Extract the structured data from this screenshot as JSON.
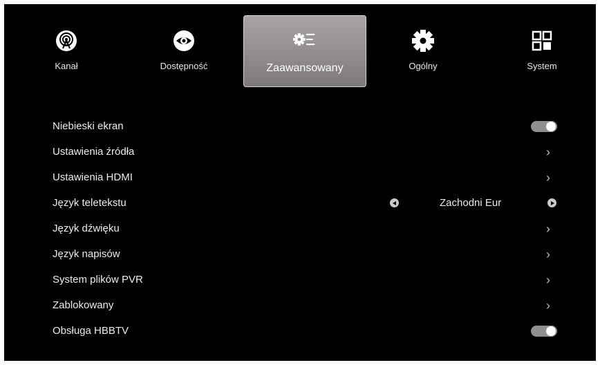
{
  "tabs": [
    {
      "label": "Kanał",
      "icon": "antenna-icon"
    },
    {
      "label": "Dostępność",
      "icon": "eye-icon"
    },
    {
      "label": "Zaawansowany",
      "icon": "gear-list-icon"
    },
    {
      "label": "Ogólny",
      "icon": "gear-icon"
    },
    {
      "label": "System",
      "icon": "grid-icon"
    }
  ],
  "active_tab": 2,
  "settings": [
    {
      "label": "Niebieski ekran",
      "control": "toggle",
      "value": "on"
    },
    {
      "label": "Ustawienia źródła",
      "control": "chevron"
    },
    {
      "label": "Ustawienia HDMI",
      "control": "chevron"
    },
    {
      "label": "Język teletekstu",
      "control": "selector",
      "value": "Zachodni Eur"
    },
    {
      "label": "Język dźwięku",
      "control": "chevron"
    },
    {
      "label": "Język napisów",
      "control": "chevron"
    },
    {
      "label": "System plików PVR",
      "control": "chevron"
    },
    {
      "label": "Zablokowany",
      "control": "chevron"
    },
    {
      "label": "Obsługa HBBTV",
      "control": "toggle",
      "value": "on"
    }
  ],
  "colors": {
    "background": "#000000",
    "active_tab": "#9a9597",
    "text": "#ececec",
    "toggle_track": "#8f8f8f"
  }
}
